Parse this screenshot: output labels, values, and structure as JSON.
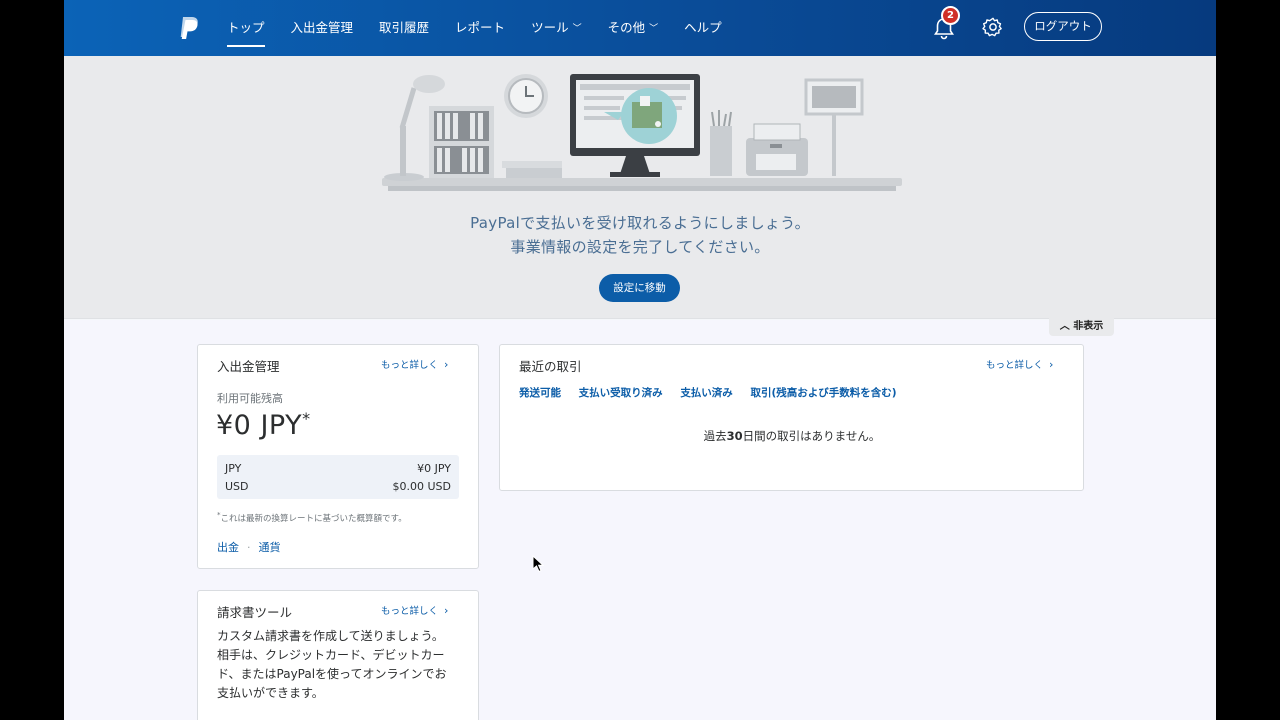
{
  "header": {
    "logo": "paypal-logo",
    "nav": [
      {
        "label": "トップ",
        "active": true
      },
      {
        "label": "入出金管理"
      },
      {
        "label": "取引履歴"
      },
      {
        "label": "レポート"
      },
      {
        "label": "ツール",
        "has_dropdown": true
      },
      {
        "label": "その他",
        "has_dropdown": true
      },
      {
        "label": "ヘルプ"
      }
    ],
    "notification_count": "2",
    "logout_label": "ログアウト"
  },
  "banner": {
    "line1": "PayPalで支払いを受け取れるようにしましょう。",
    "line2": "事業情報の設定を完了してください。",
    "button_label": "設定に移動",
    "hide_label": "非表示"
  },
  "balance_card": {
    "title": "入出金管理",
    "more_link": "もっと詳しく",
    "available_label": "利用可能残高",
    "amount": "¥0 JPY",
    "amount_mark": "*",
    "currencies": [
      {
        "code": "JPY",
        "value": "¥0 JPY"
      },
      {
        "code": "USD",
        "value": "$0.00 USD"
      }
    ],
    "footnote_mark": "*",
    "footnote": "これは最新の換算レートに基づいた概算額です。",
    "link_withdraw": "出金",
    "link_separator": "·",
    "link_currency": "通貨"
  },
  "transactions_card": {
    "title": "最近の取引",
    "more_link": "もっと詳しく",
    "filters": [
      "発送可能",
      "支払い受取り済み",
      "支払い済み",
      "取引(残高および手数料を含む)"
    ],
    "empty_prefix": "過去",
    "empty_days": "30",
    "empty_suffix": "日間の取引はありません。"
  },
  "invoice_card": {
    "title": "請求書ツール",
    "more_link": "もっと詳しく",
    "description": "カスタム請求書を作成して送りましょう。相手は、クレジットカード、デビットカード、またはPayPalを使ってオンラインでお支払いができます。"
  },
  "colors": {
    "header_start": "#0b63b7",
    "header_end": "#063a7e",
    "link": "#0c5da8",
    "badge": "#d03027"
  }
}
